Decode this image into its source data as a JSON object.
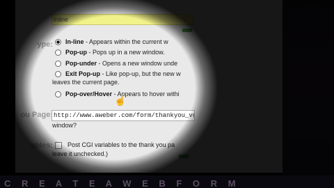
{
  "form": {
    "name_value": "inline",
    "type_label": "ype:",
    "options": [
      {
        "name": "In-line",
        "desc": "- Appears within the current w"
      },
      {
        "name": "Pop-up",
        "desc": "- Pops up in a new window."
      },
      {
        "name": "Pop-under",
        "desc": "- Opens a new window unde"
      },
      {
        "name": "Exit Pop-up",
        "desc": "- Like pop-up, but the new w"
      }
    ],
    "exit_popup_cont": "leaves the current page.",
    "popover": {
      "name": "Pop-over/Hover",
      "desc": "- Appears to hover withi"
    },
    "thankyou_label": "ou Page:",
    "thankyou_url": "http://www.aweber.com/form/thankyou_vo.html",
    "thankyou_note": "window?",
    "variables_label": "ables:",
    "cgi_label": "Post CGI variables to the thank you pa",
    "cgi_note": "leave it unchecked.)"
  },
  "background_text": "C R E A T E   A   W E B   F O R M"
}
